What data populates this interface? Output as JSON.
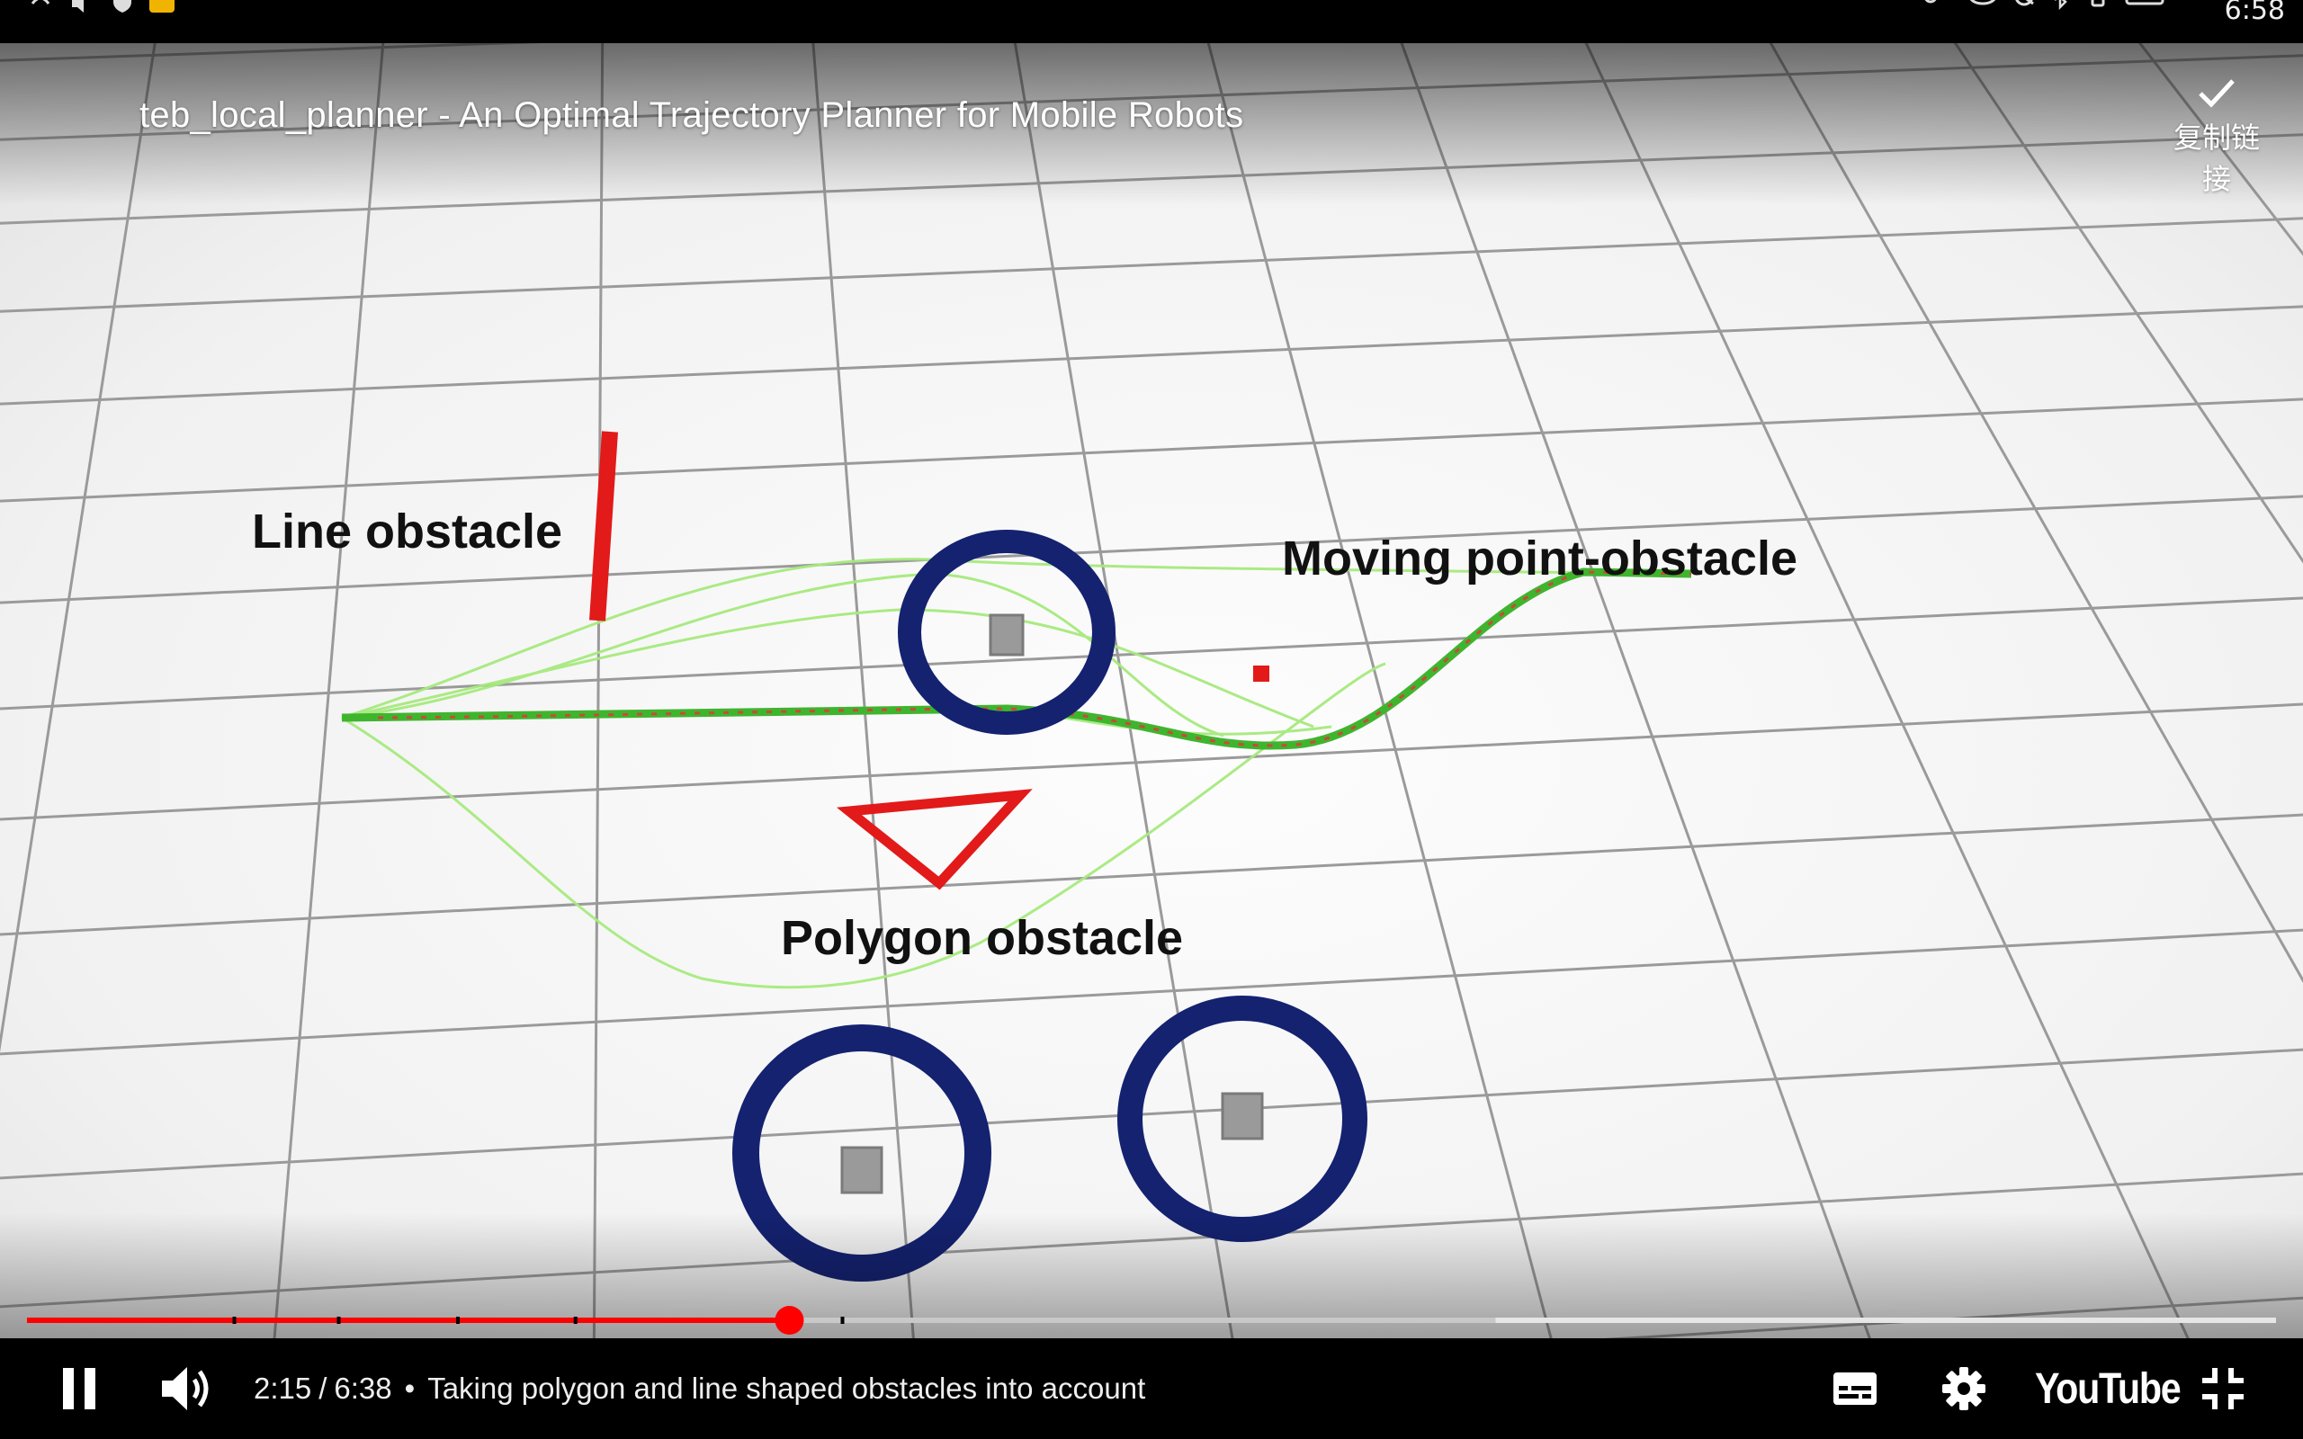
{
  "status_bar": {
    "time": "6:58",
    "icons_left": [
      "hotspot-icon",
      "volume-icon",
      "shield-icon",
      "app-notification-icon"
    ],
    "icons_right": [
      "vpn-key-icon",
      "eye-icon",
      "mute-icon",
      "bluetooth-icon",
      "vibrate-icon",
      "battery-icon"
    ]
  },
  "video": {
    "title": "teb_local_planner - An Optimal Trajectory Planner for Mobile Robots",
    "copy_link_label": "复制链接",
    "annotations": {
      "line_obstacle": "Line obstacle",
      "moving_point_obstacle": "Moving point-obstacle",
      "polygon_obstacle": "Polygon obstacle"
    }
  },
  "player": {
    "current_time": "2:15",
    "separator": "/",
    "duration": "6:38",
    "chapter_separator": "•",
    "chapter": "Taking polygon and line shaped obstacles into account",
    "progress_fraction": 0.339,
    "buffered_fraction": 0.653,
    "brand": "YouTube",
    "colors": {
      "played": "#ff0000",
      "buffered": "#c8c8c8",
      "unplayed": "#e6e6e6",
      "accent": "#ff0000"
    }
  }
}
